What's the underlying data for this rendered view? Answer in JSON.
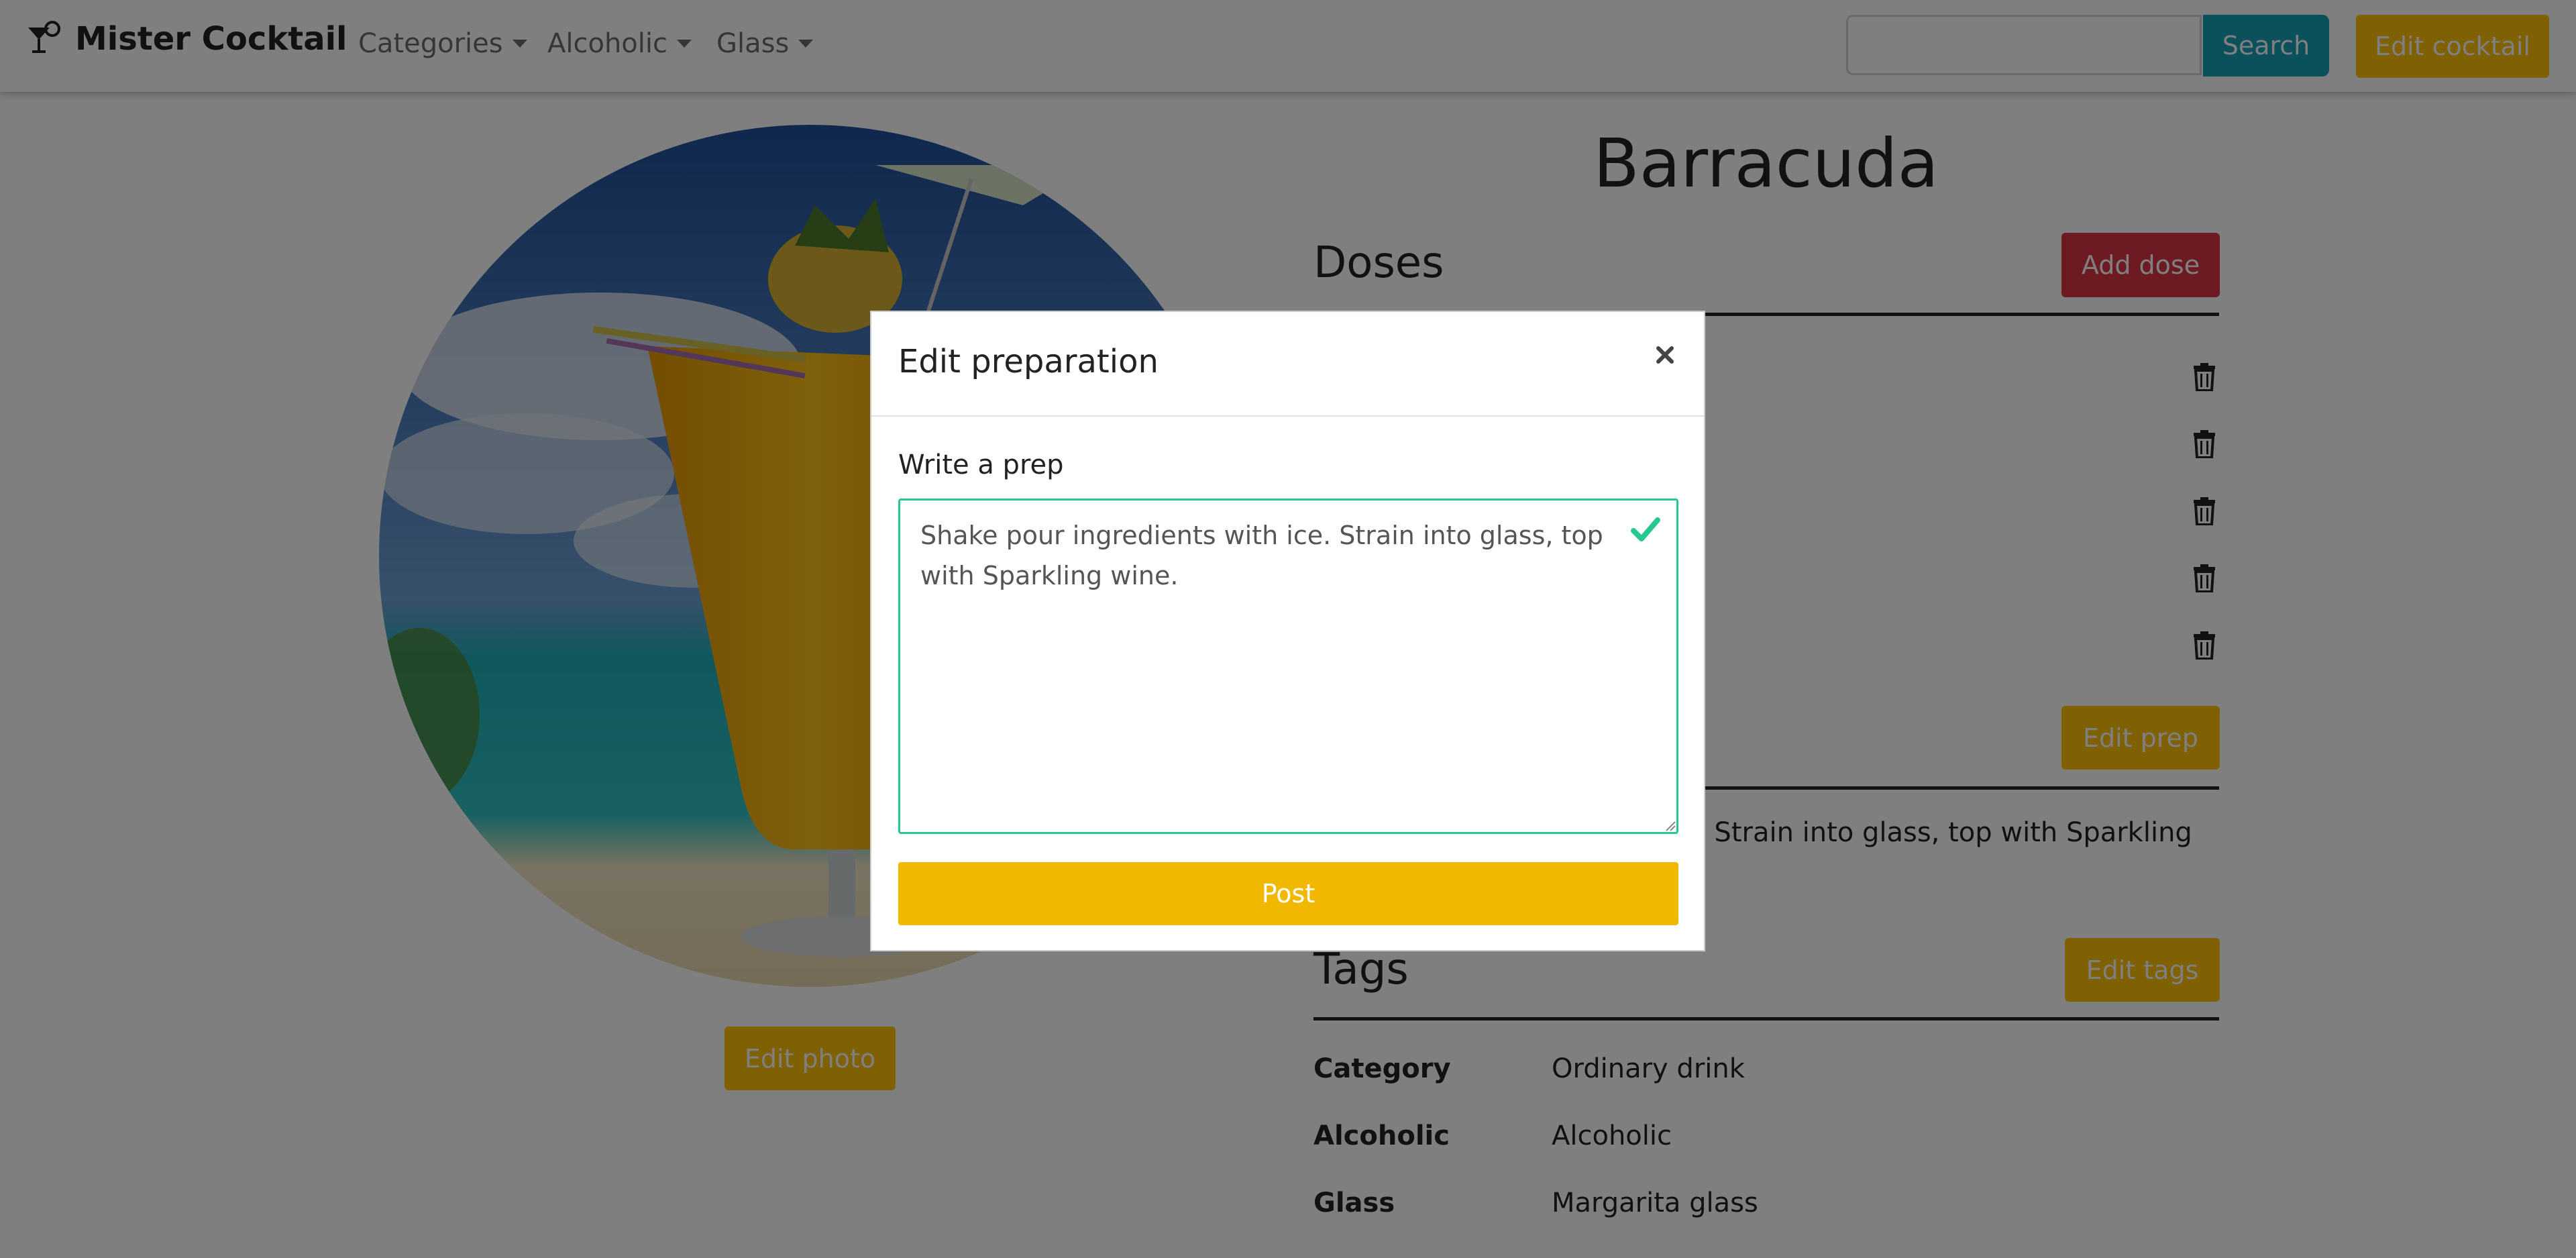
{
  "navbar": {
    "brand": "Mister Cocktail",
    "menus": [
      "Categories",
      "Alcoholic",
      "Glass"
    ],
    "search": {
      "value": "",
      "placeholder": "",
      "button": "Search"
    },
    "edit_cocktail": "Edit cocktail"
  },
  "cocktail": {
    "name": "Barracuda",
    "edit_photo": "Edit photo",
    "doses": {
      "title": "Doses",
      "add_button": "Add dose"
    },
    "preparation": {
      "edit_button": "Edit prep",
      "visible_text": ". Strain into glass, top with Sparkling"
    },
    "tags": {
      "title": "Tags",
      "edit_button": "Edit tags",
      "rows": [
        {
          "label": "Category",
          "value": "Ordinary drink"
        },
        {
          "label": "Alcoholic",
          "value": "Alcoholic"
        },
        {
          "label": "Glass",
          "value": "Margarita glass"
        }
      ]
    }
  },
  "modal": {
    "title": "Edit preparation",
    "field_label": "Write a prep",
    "textarea_value": "Shake pour ingredients with ice. Strain into glass, top with Sparkling wine.",
    "submit": "Post"
  },
  "colors": {
    "warning": "#ffc107",
    "danger": "#dc3545",
    "info": "#17a2b8",
    "valid": "#28c98f",
    "post": "#f0b800"
  }
}
